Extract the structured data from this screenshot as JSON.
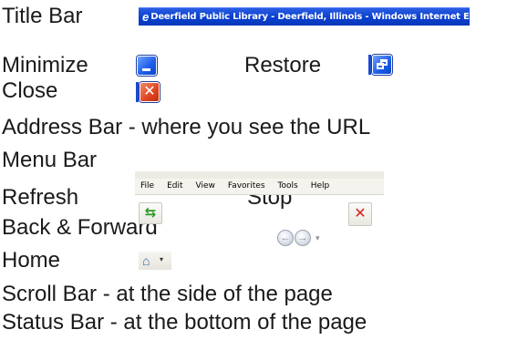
{
  "rows": {
    "title_bar": "Title Bar",
    "minimize": "Minimize",
    "restore": "Restore",
    "close": "Close",
    "address_bar": "Address Bar - where you see the URL",
    "menu_bar": "Menu Bar",
    "refresh": "Refresh",
    "stop": "Stop",
    "back_forward": "Back & Forward",
    "home": "Home",
    "scroll_bar": "Scroll Bar  - at the side of the page",
    "status_bar": "Status Bar - at the bottom of the page"
  },
  "title_bar_image": {
    "text": "Deerfield Public Library - Deerfield, Illinois - Windows Internet Explorer",
    "icon": "ie-logo-icon",
    "color": "#0a3fd0"
  },
  "menu_bar_image": {
    "items": [
      "File",
      "Edit",
      "View",
      "Favorites",
      "Tools",
      "Help"
    ]
  },
  "icons": {
    "minimize": "minimize-icon",
    "restore": "restore-icon",
    "close": "close-icon",
    "refresh": "refresh-icon",
    "stop": "stop-icon",
    "back": "back-arrow-icon",
    "forward": "forward-arrow-icon",
    "home": "home-icon"
  },
  "colors": {
    "xp_blue": "#1a5ce8",
    "xp_red": "#e04320",
    "refresh_green": "#2e9a25",
    "stop_red": "#d8201a"
  }
}
